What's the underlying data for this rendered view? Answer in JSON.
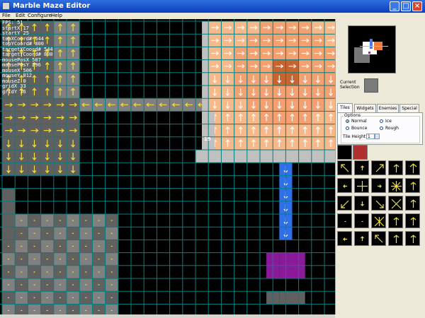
{
  "window": {
    "title": "Marble Maze Editor"
  },
  "menu": [
    "File",
    "Edit",
    "Configure",
    "Help"
  ],
  "stats": [
    "FPS: 51",
    "startX 17",
    "startY 25",
    "topXCoord# 544",
    "topYCoord# 800",
    "",
    "targetXCoord# 544",
    "targetYCoord# 800",
    "mousePosX 507",
    "mousePosY 296",
    "mouseX 506",
    "mouseY 812",
    "mouseZ 0",
    "gridX 33",
    "gridY 36"
  ],
  "grid_label": "19",
  "panel": {
    "current_selection_label": "Current Selection",
    "tabs": [
      "Tiles",
      "Widgets",
      "Enemies",
      "Special"
    ],
    "options_label": "Options",
    "radios": [
      {
        "label": "Normal",
        "checked": true
      },
      {
        "label": "Ice",
        "checked": false
      },
      {
        "label": "Bounce",
        "checked": false
      },
      {
        "label": "Rough",
        "checked": false
      }
    ],
    "tile_height_label": "Tile Height",
    "tile_height_value": "1"
  },
  "colors": {
    "orange": "#f5a070",
    "orange_light": "#f8b88a",
    "orange_dark": "#c86430",
    "gray_light": "#c0c0c0",
    "gray_mid": "#808080",
    "gray_dark": "#606060",
    "blue": "#2f6fe8",
    "purple": "#8b1a9b",
    "grid": "#008080",
    "arrow": "#f0e040"
  },
  "palette_icons": [
    "diag-ul",
    "up-dot",
    "diag-ur",
    "up",
    "up-big",
    "left-dot",
    "four-way",
    "right-dot",
    "star",
    "up",
    "diag-dl",
    "down-dot",
    "diag-dr",
    "four-diag",
    "up",
    "dot",
    "dot",
    "x-cross",
    "up",
    "up",
    "left-dot",
    "up-dot",
    "diag-ul",
    "up",
    "up"
  ]
}
